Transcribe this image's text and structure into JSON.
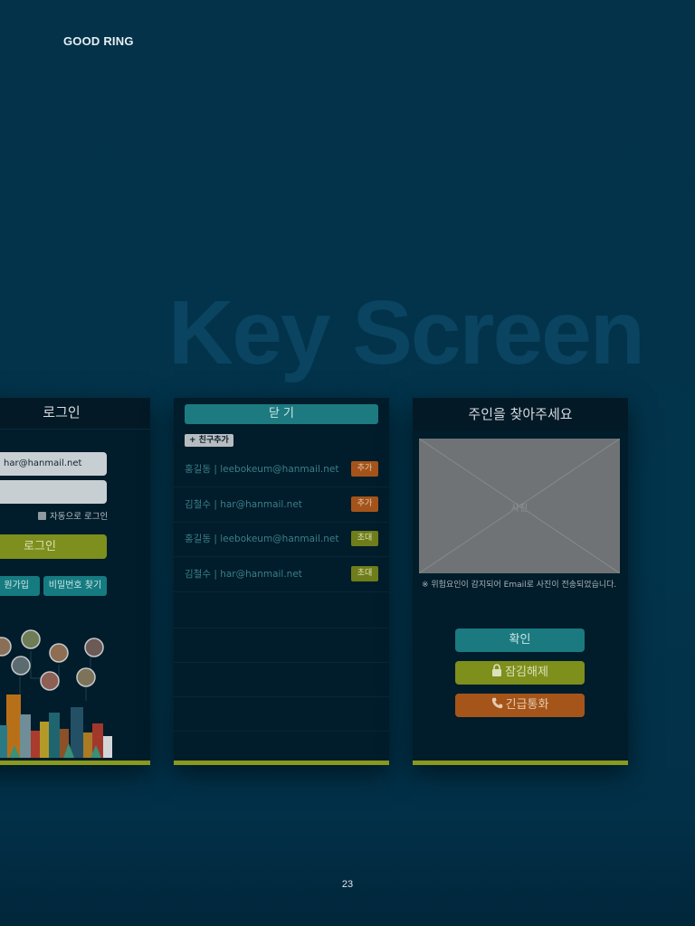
{
  "header": {
    "brand": "GOOD RING"
  },
  "hero": {
    "title": "Key Screen"
  },
  "footer": {
    "page_number": "23"
  },
  "login_screen": {
    "title": "로그인",
    "email_value": "har@hanmail.net",
    "auto_login_label": "자동으로 로그인",
    "login_button": "로그인",
    "signup_button": "원가입",
    "find_password_button": "비밀번호 찾기"
  },
  "friends_screen": {
    "close_button": "닫 기",
    "add_friend_button": "+ 친구추가",
    "rows": [
      {
        "text": "홍길동   |   leebokeum@hanmail.net",
        "action": "추가",
        "kind": "add"
      },
      {
        "text": "김철수   |   har@hanmail.net",
        "action": "추가",
        "kind": "add"
      },
      {
        "text": "홍길동   |   leebokeum@hanmail.net",
        "action": "초대",
        "kind": "invite"
      },
      {
        "text": "김철수   |   har@hanmail.net",
        "action": "초대",
        "kind": "invite"
      }
    ]
  },
  "owner_screen": {
    "title": "주인을 찾아주세요",
    "photo_label": "사진",
    "notice": "※ 위험요인이 감지되어 Email로 사진이 전송되었습니다.",
    "confirm_button": "확인",
    "unlock_button": "잠김해제",
    "emergency_button": "긴급통화"
  },
  "colors": {
    "background": "#02344c",
    "teal": "#1a7a80",
    "olive": "#7e8f1c",
    "orange": "#a55519"
  }
}
